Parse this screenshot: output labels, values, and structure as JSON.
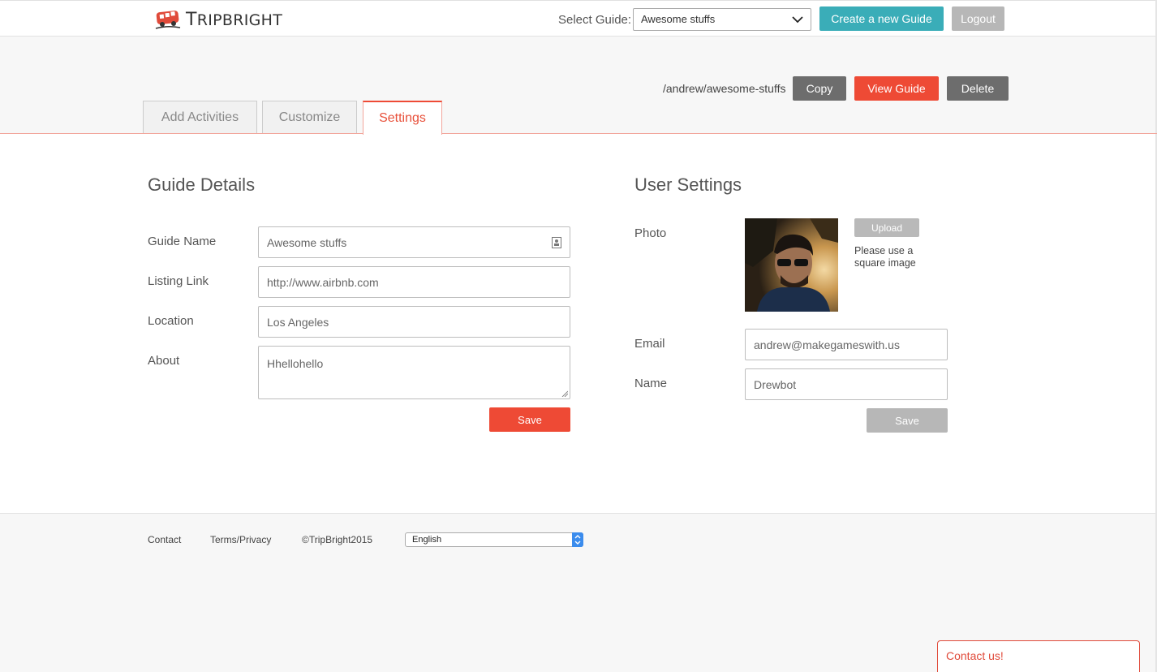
{
  "header": {
    "logo_text_big": "T",
    "logo_text_rest": "RIPBRIGHT",
    "select_guide_label": "Select Guide:",
    "selected_guide": "Awesome stuffs",
    "create_guide_label": "Create a new Guide",
    "logout_label": "Logout"
  },
  "guide_bar": {
    "url": "/andrew/awesome-stuffs",
    "copy_label": "Copy",
    "view_label": "View Guide",
    "delete_label": "Delete"
  },
  "tabs": [
    {
      "label": "Add Activities",
      "active": false
    },
    {
      "label": "Customize",
      "active": false
    },
    {
      "label": "Settings",
      "active": true
    }
  ],
  "guide_details": {
    "title": "Guide Details",
    "fields": [
      {
        "label": "Guide Name",
        "value": "Awesome stuffs"
      },
      {
        "label": "Listing Link",
        "value": "http://www.airbnb.com"
      },
      {
        "label": "Location",
        "value": "Los Angeles"
      },
      {
        "label": "About",
        "value": "Hhellohello"
      }
    ],
    "save_label": "Save"
  },
  "user_settings": {
    "title": "User Settings",
    "photo_label": "Photo",
    "upload_label": "Upload",
    "photo_hint": "Please use a square image",
    "email_label": "Email",
    "email_value": "andrew@makegameswith.us",
    "name_label": "Name",
    "name_value": "Drewbot",
    "save_label": "Save"
  },
  "footer": {
    "contact_label": "Contact",
    "terms_label": "Terms/Privacy",
    "copyright": "©TripBright2015",
    "language": "English"
  },
  "contact_widget": {
    "label": "Contact us!"
  },
  "colors": {
    "accent_red": "#ee4a35",
    "teal": "#3aadb8",
    "dark_gray": "#6d6d6d",
    "light_gray": "#b7b7b7"
  }
}
